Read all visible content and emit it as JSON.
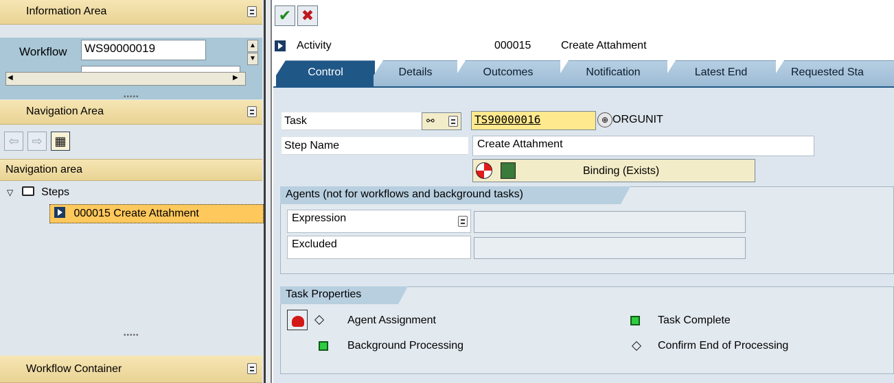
{
  "info_area": {
    "title": "Information Area",
    "workflow_label": "Workflow",
    "workflow_value": "WS90000019"
  },
  "nav_area": {
    "title": "Navigation Area",
    "header": "Navigation area"
  },
  "tree": {
    "root": "Steps",
    "selected_item": "000015 Create Attahment"
  },
  "workflow_container": {
    "title": "Workflow Container"
  },
  "toolbar": {
    "confirm_icon": "check-icon",
    "cancel_icon": "cancel-icon"
  },
  "activity": {
    "type": "Activity",
    "number": "000015",
    "name": "Create Attahment"
  },
  "tabs": [
    "Control",
    "Details",
    "Outcomes",
    "Notification",
    "Latest End",
    "Requested Sta"
  ],
  "control": {
    "task_label": "Task",
    "task_value": "TS90000016",
    "task_type": "ORGUNIT",
    "step_name_label": "Step Name",
    "step_name_value": "Create Attahment",
    "binding_button": "Binding (Exists)"
  },
  "agents": {
    "title": "Agents (not for workflows and background tasks)",
    "expression_label": "Expression",
    "excluded_label": "Excluded"
  },
  "task_properties": {
    "title": "Task Properties",
    "agent_assignment": "Agent Assignment",
    "background_processing": "Background Processing",
    "task_complete": "Task Complete",
    "confirm_end": "Confirm End of Processing"
  }
}
